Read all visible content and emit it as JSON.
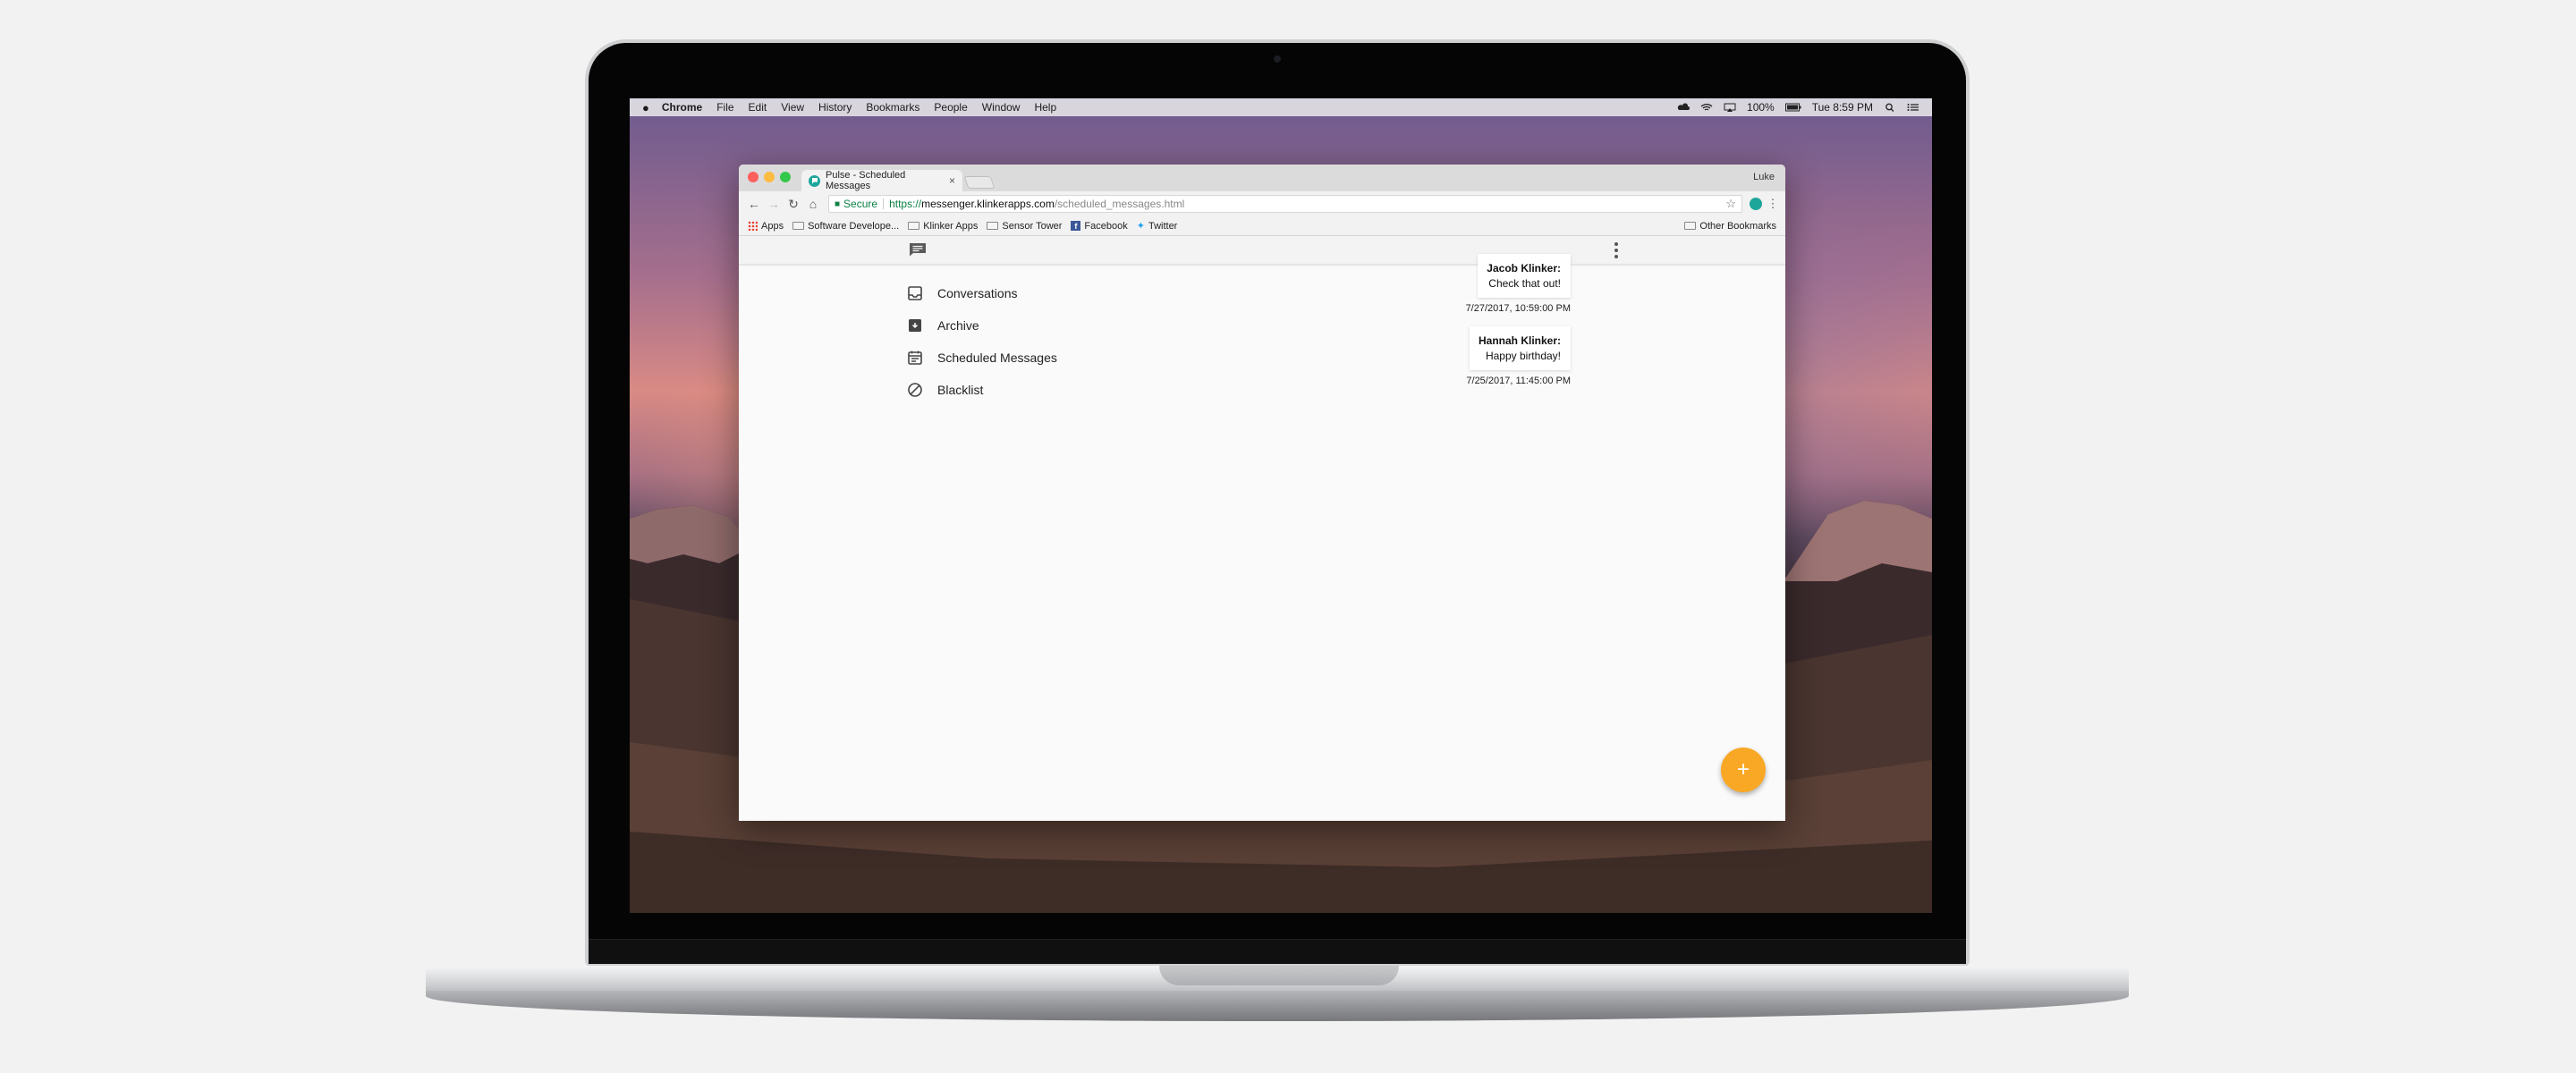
{
  "menubar": {
    "apple_icon": "apple-icon",
    "app_name": "Chrome",
    "items": [
      "File",
      "Edit",
      "View",
      "History",
      "Bookmarks",
      "People",
      "Window",
      "Help"
    ],
    "battery": "100%",
    "clock": "Tue 8:59 PM"
  },
  "browser": {
    "tab_title": "Pulse - Scheduled Messages",
    "profile_name": "Luke",
    "url": {
      "secure_label": "Secure",
      "scheme": "https://",
      "host": "messenger.klinkerapps.com",
      "path": "/scheduled_messages.html"
    },
    "bookmarks": [
      "Apps",
      "Software Develope...",
      "Klinker Apps",
      "Sensor Tower",
      "Facebook",
      "Twitter"
    ],
    "other_bookmarks": "Other Bookmarks"
  },
  "app": {
    "nav": [
      {
        "label": "Conversations",
        "icon": "inbox-icon"
      },
      {
        "label": "Archive",
        "icon": "archive-icon"
      },
      {
        "label": "Scheduled Messages",
        "icon": "calendar-icon"
      },
      {
        "label": "Blacklist",
        "icon": "block-icon"
      }
    ],
    "scheduled": [
      {
        "sender": "Jacob Klinker:",
        "text": "Check that out!",
        "timestamp": "7/27/2017, 10:59:00 PM"
      },
      {
        "sender": "Hannah Klinker:",
        "text": "Happy birthday!",
        "timestamp": "7/25/2017, 11:45:00 PM"
      }
    ],
    "fab_label": "+"
  },
  "colors": {
    "accent": "#f9a825",
    "brand_teal": "#1ea69a",
    "secure_green": "#0b8043"
  }
}
